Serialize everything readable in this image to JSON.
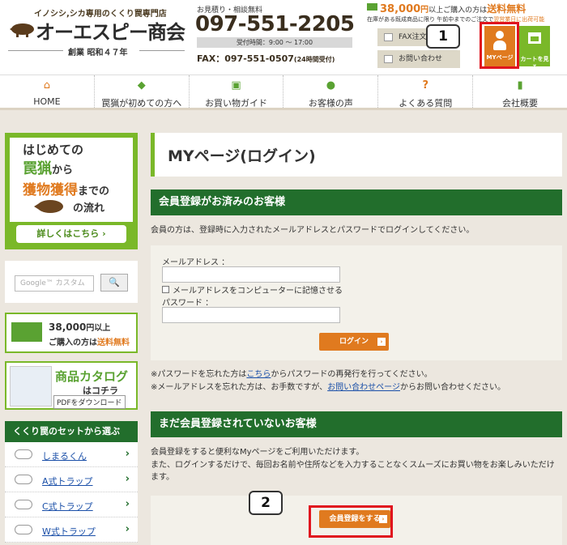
{
  "header": {
    "tagline": "イノシシ,シカ専用のくくり罠専門店",
    "shop_name": "オーエスピー商会",
    "founded": "創業 昭和４７年",
    "contact_label": "お見積り・相談無料",
    "tel": "097-551-2205",
    "hours": "受付時間：9:00 ～ 17:00",
    "fax_label": "FAX：",
    "fax_number": "097-551-0507",
    "fax_note": "(24時間受付)",
    "ship_amount": "38,000",
    "ship_unit": "円",
    "ship_text": "以上ご購入の方は",
    "ship_free": "送料無料",
    "ship_sub": "在庫がある既成商品に限り 午前中までのご注文で",
    "ship_sub_hl": "翌営業日に出荷可能",
    "fax_order_label": "FAX注文",
    "contact_btn_label": "お問い合わせ",
    "mypage_label": "MYページ",
    "cart_label": "カートを見る"
  },
  "callouts": {
    "first": "1",
    "second": "2"
  },
  "nav": [
    {
      "label": "HOME",
      "icon": "house-icon"
    },
    {
      "label": "罠猟が初めての方へ",
      "icon": "beginner-mark-icon"
    },
    {
      "label": "お買い物ガイド",
      "icon": "cart-icon"
    },
    {
      "label": "お客様の声",
      "icon": "speech-bubble-icon"
    },
    {
      "label": "よくある質問",
      "icon": "question-icon"
    },
    {
      "label": "会社概要",
      "icon": "building-icon"
    }
  ],
  "sidebar": {
    "banner_line1": "はじめての",
    "banner_line2a": "罠猟",
    "banner_line2b": "から",
    "banner_line3a": "獲物獲得",
    "banner_line3b": "までの",
    "banner_line4": "の流れ",
    "banner_button": "詳しくはこちら ›",
    "search_placeholder": "Google™ カスタム",
    "search_button": "🔍",
    "ship_amount": "38,000",
    "ship_unit": "円以上",
    "ship_text": "ご購入の方は",
    "ship_free": "送料無料",
    "catalog_title": "商品カタログ",
    "catalog_sub": "はコチラ",
    "catalog_pdf": "PDFをダウンロード",
    "set_title": "くくり罠のセットから選ぶ",
    "set_items": [
      "しまるくん",
      "A式トラップ",
      "C式トラップ",
      "W式トラップ"
    ],
    "arrow": "›"
  },
  "main": {
    "page_title": "MYページ(ログイン)",
    "registered_title": "会員登録がお済みのお客様",
    "registered_desc": "会員の方は、登録時に入力されたメールアドレスとパスワードでログインしてください。",
    "email_label": "メールアドレス ：",
    "remember_label": "メールアドレスをコンピューターに記憶させる",
    "password_label": "パスワード ：",
    "login_button": "ログイン",
    "forgot_pre": "※パスワードを忘れた方は",
    "forgot_link": "こちら",
    "forgot_post": "からパスワードの再発行を行ってください。",
    "email_forgot_pre": "※メールアドレスを忘れた方は、お手数ですが、",
    "email_forgot_link": "お問い合わせページ",
    "email_forgot_post": "からお問い合わせください。",
    "unregistered_title": "まだ会員登録されていないお客様",
    "unregistered_desc1": "会員登録をすると便利なMyページをご利用いただけます。",
    "unregistered_desc2": "また、ログインするだけで、毎回お名前や住所などを入力することなくスムーズにお買い物をお楽しみいただけます。",
    "register_button": "会員登録をする",
    "button_arrow": "›"
  },
  "colors": {
    "accent": "#e07a1f",
    "green": "#226e2c",
    "lime": "#7ab829",
    "highlight": "#e0141e"
  }
}
